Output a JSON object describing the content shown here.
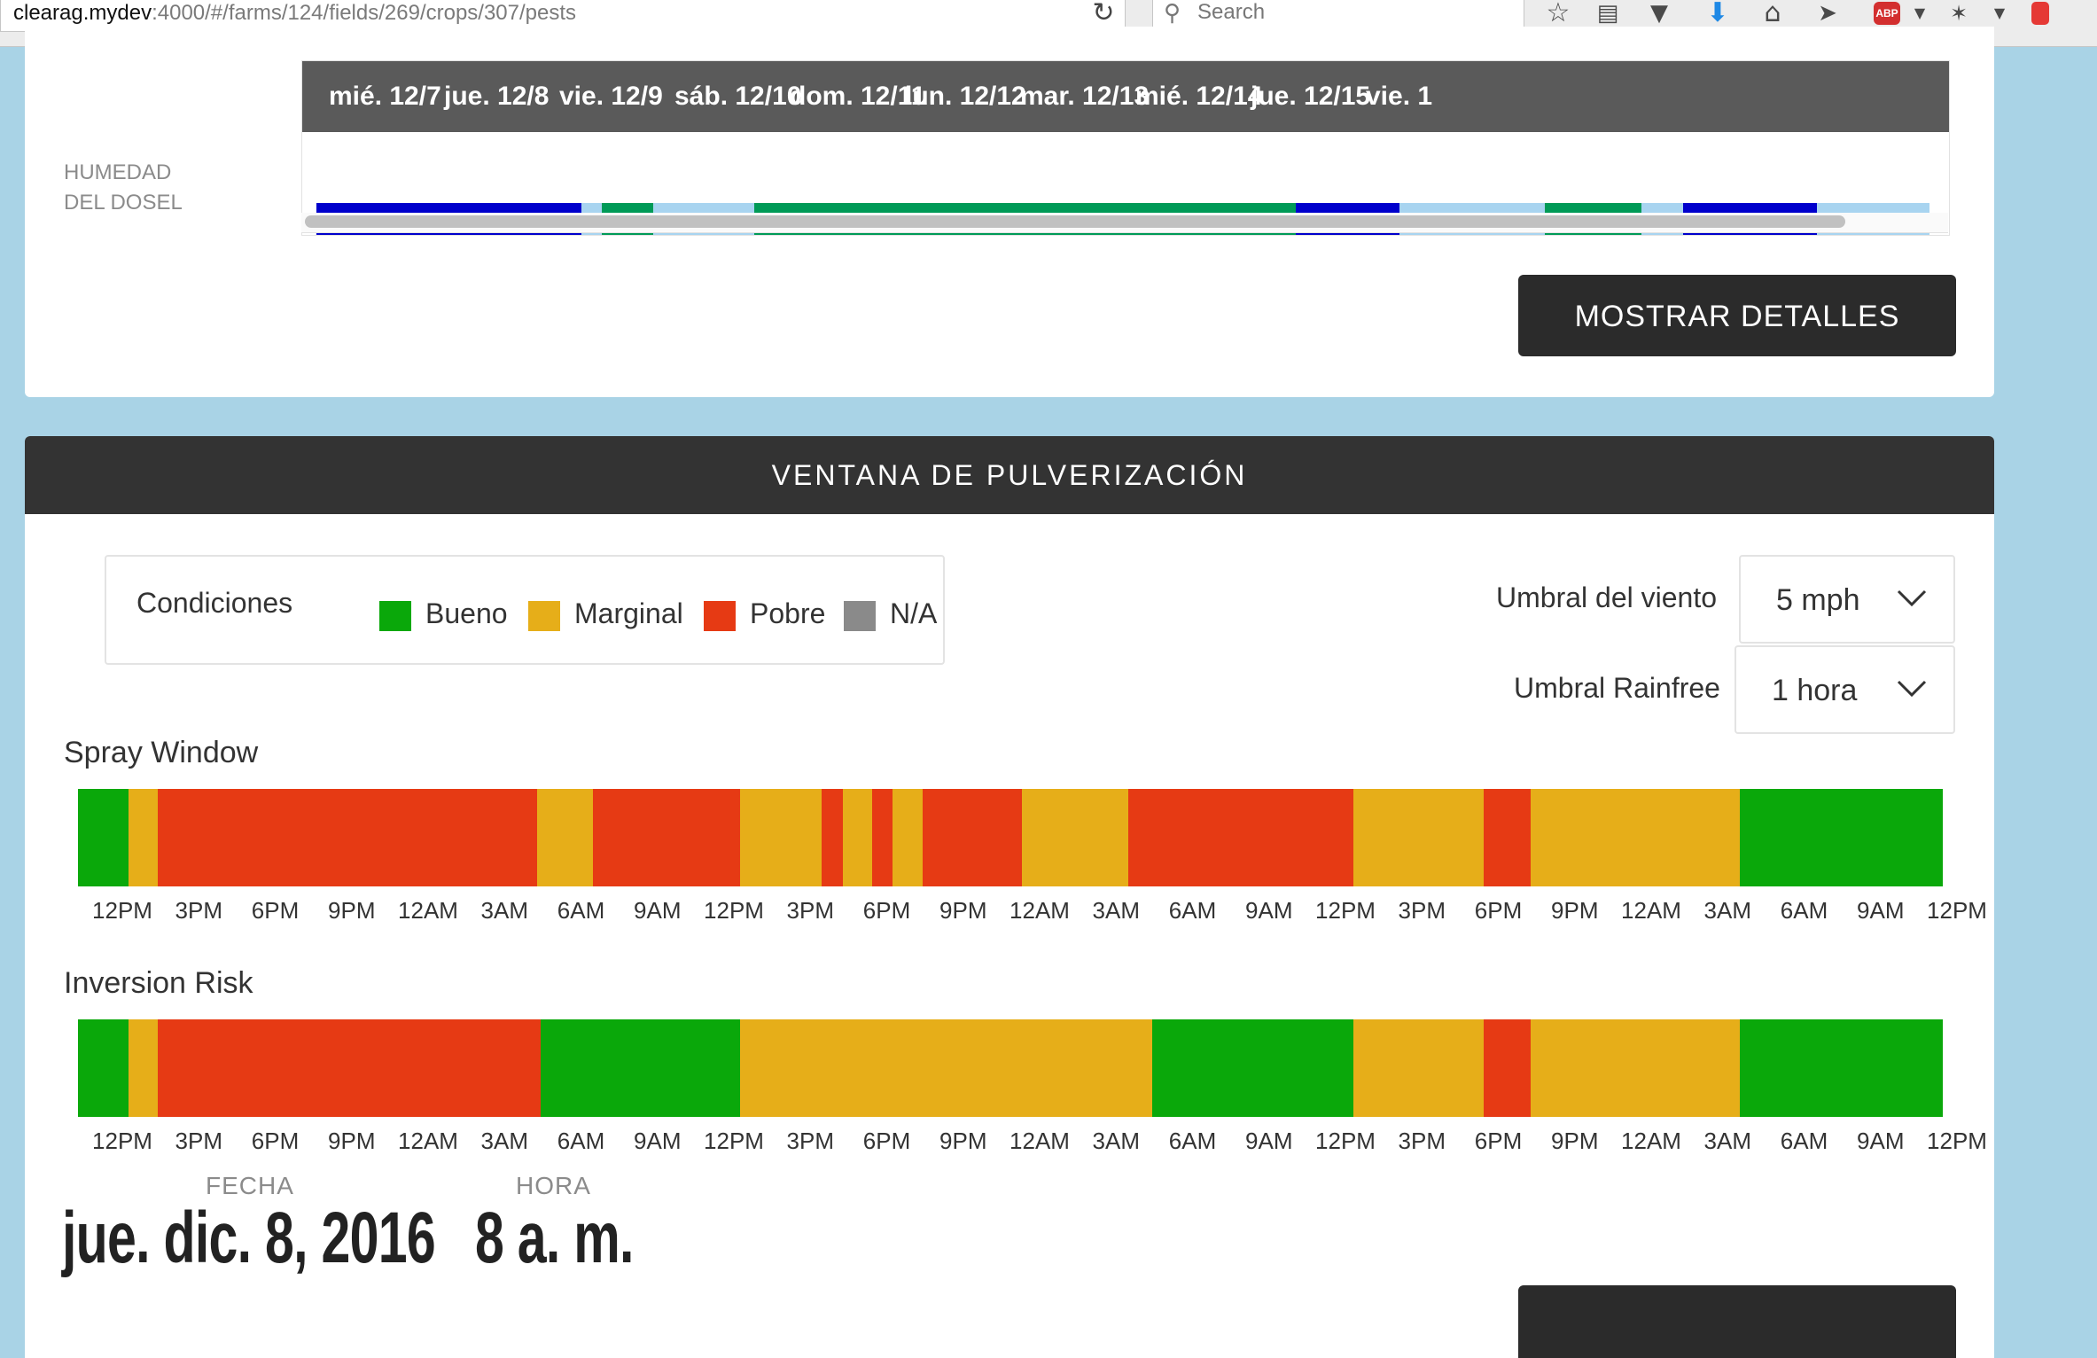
{
  "browser": {
    "url_host": "clearag.mydev",
    "url_path": ":4000/#/farms/124/fields/269/crops/307/pests",
    "search_placeholder": "Search",
    "abp_label": "ABP"
  },
  "canopy": {
    "label": "HUMEDAD DEL DOSEL",
    "days": [
      "mié. 12/7",
      "jue. 12/8",
      "vie. 12/9",
      "sáb. 12/10",
      "dom. 12/11",
      "lun. 12/12",
      "mar. 12/13",
      "mié. 12/14",
      "jue. 12/15",
      "vie. 1"
    ],
    "segments": [
      {
        "color": "#0000cc",
        "from": 0.0,
        "to": 0.115
      },
      {
        "color": "#a8d4f0",
        "from": 0.115,
        "to": 0.124
      },
      {
        "color": "#009a57",
        "from": 0.124,
        "to": 0.146
      },
      {
        "color": "#a8d4f0",
        "from": 0.146,
        "to": 0.19
      },
      {
        "color": "#009a57",
        "from": 0.19,
        "to": 0.425
      },
      {
        "color": "#0000cc",
        "from": 0.425,
        "to": 0.47
      },
      {
        "color": "#a8d4f0",
        "from": 0.47,
        "to": 0.533
      },
      {
        "color": "#009a57",
        "from": 0.533,
        "to": 0.575
      },
      {
        "color": "#a8d4f0",
        "from": 0.575,
        "to": 0.593
      },
      {
        "color": "#0000cc",
        "from": 0.593,
        "to": 0.651
      },
      {
        "color": "#a8d4f0",
        "from": 0.651,
        "to": 0.7
      }
    ],
    "details_button": "MOSTRAR DETALLES"
  },
  "spray": {
    "header": "VENTANA DE PULVERIZACIÓN",
    "legend": {
      "title": "Condiciones",
      "items": [
        {
          "label": "Bueno",
          "color": "#0aa80a"
        },
        {
          "label": "Marginal",
          "color": "#e6ae19"
        },
        {
          "label": "Pobre",
          "color": "#e63a14"
        },
        {
          "label": "N/A",
          "color": "#8a8a8a"
        }
      ]
    },
    "wind_threshold": {
      "label": "Umbral del viento",
      "value": "5 mph"
    },
    "rainfree_threshold": {
      "label": "Umbral Rainfree",
      "value": "1 hora"
    },
    "time_ticks": [
      "12PM",
      "3PM",
      "6PM",
      "9PM",
      "12AM",
      "3AM",
      "6AM",
      "9AM",
      "12PM",
      "3PM",
      "6PM",
      "9PM",
      "12AM",
      "3AM",
      "6AM",
      "9AM",
      "12PM",
      "3PM",
      "6PM",
      "9PM",
      "12AM",
      "3AM",
      "6AM",
      "9AM",
      "12PM"
    ],
    "rows": [
      {
        "title": "Spray Window",
        "segments": [
          {
            "condition": "Bueno",
            "from": 0.0,
            "to": 0.027
          },
          {
            "condition": "Marginal",
            "from": 0.027,
            "to": 0.043
          },
          {
            "condition": "Pobre",
            "from": 0.043,
            "to": 0.246
          },
          {
            "condition": "Marginal",
            "from": 0.246,
            "to": 0.276
          },
          {
            "condition": "Pobre",
            "from": 0.276,
            "to": 0.355
          },
          {
            "condition": "Marginal",
            "from": 0.355,
            "to": 0.399
          },
          {
            "condition": "Pobre",
            "from": 0.399,
            "to": 0.41
          },
          {
            "condition": "Marginal",
            "from": 0.41,
            "to": 0.426
          },
          {
            "condition": "Pobre",
            "from": 0.426,
            "to": 0.437
          },
          {
            "condition": "Marginal",
            "from": 0.437,
            "to": 0.453
          },
          {
            "condition": "Pobre",
            "from": 0.453,
            "to": 0.506
          },
          {
            "condition": "Marginal",
            "from": 0.506,
            "to": 0.563
          },
          {
            "condition": "Pobre",
            "from": 0.563,
            "to": 0.684
          },
          {
            "condition": "Marginal",
            "from": 0.684,
            "to": 0.754
          },
          {
            "condition": "Pobre",
            "from": 0.754,
            "to": 0.779
          },
          {
            "condition": "Marginal",
            "from": 0.779,
            "to": 0.891
          },
          {
            "condition": "Bueno",
            "from": 0.891,
            "to": 1.0
          }
        ]
      },
      {
        "title": "Inversion Risk",
        "segments": [
          {
            "condition": "Bueno",
            "from": 0.0,
            "to": 0.027
          },
          {
            "condition": "Marginal",
            "from": 0.027,
            "to": 0.043
          },
          {
            "condition": "Pobre",
            "from": 0.043,
            "to": 0.248
          },
          {
            "condition": "Bueno",
            "from": 0.248,
            "to": 0.355
          },
          {
            "condition": "Marginal",
            "from": 0.355,
            "to": 0.576
          },
          {
            "condition": "Bueno",
            "from": 0.576,
            "to": 0.684
          },
          {
            "condition": "Marginal",
            "from": 0.684,
            "to": 0.754
          },
          {
            "condition": "Pobre",
            "from": 0.754,
            "to": 0.779
          },
          {
            "condition": "Marginal",
            "from": 0.779,
            "to": 0.891
          },
          {
            "condition": "Bueno",
            "from": 0.891,
            "to": 1.0
          }
        ]
      }
    ],
    "date_label": "FECHA",
    "date_value": "jue. dic. 8, 2016",
    "time_label": "HORA",
    "time_value": "8 a. m."
  }
}
